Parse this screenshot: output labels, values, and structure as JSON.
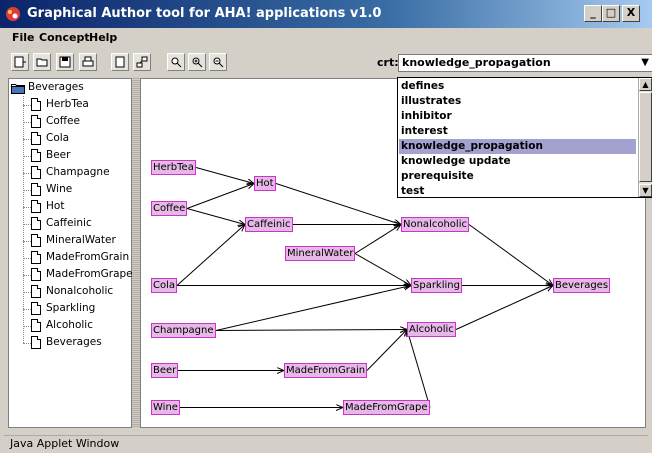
{
  "window": {
    "title": "Graphical Author tool for AHA! applications v1.0",
    "minimize": "_",
    "maximize": "□",
    "close": "X"
  },
  "menu": {
    "file": "File",
    "concept": "Concept",
    "help": "Help"
  },
  "toolbar": {
    "buttons": [
      "new-doc-icon",
      "folder-icon",
      "save-icon",
      "print-icon",
      "page-icon",
      "link-icon",
      "zoom-icon",
      "zoom-in-icon",
      "zoom-out-icon"
    ],
    "crt_label": "crt:",
    "crt_value": "knowledge_propagation"
  },
  "dropdown": {
    "items": [
      "defines",
      "illustrates",
      "inhibitor",
      "interest",
      "knowledge_propagation",
      "knowledge update",
      "prerequisite",
      "test"
    ],
    "selected_index": 4
  },
  "tree": {
    "root": "Beverages",
    "items": [
      "HerbTea",
      "Coffee",
      "Cola",
      "Beer",
      "Champagne",
      "Wine",
      "Hot",
      "Caffeinic",
      "MineralWater",
      "MadeFromGrain",
      "MadeFromGrape",
      "Nonalcoholic",
      "Sparkling",
      "Alcoholic",
      "Beverages"
    ]
  },
  "graph": {
    "nodes": [
      "HerbTea",
      "Coffee",
      "Hot",
      "Caffeinic",
      "MineralWater",
      "Nonalcoholic",
      "Cola",
      "Sparkling",
      "Beverages",
      "Champagne",
      "Alcoholic",
      "Beer",
      "MadeFromGrain",
      "Wine",
      "MadeFromGrape"
    ]
  },
  "status": {
    "text": "Java Applet Window"
  },
  "colors": {
    "title_start": "#0a246a",
    "title_end": "#a6caf0",
    "node_fill": "#e6b8e6",
    "node_border": "#cc33cc",
    "selection": "#a3a1cf"
  }
}
